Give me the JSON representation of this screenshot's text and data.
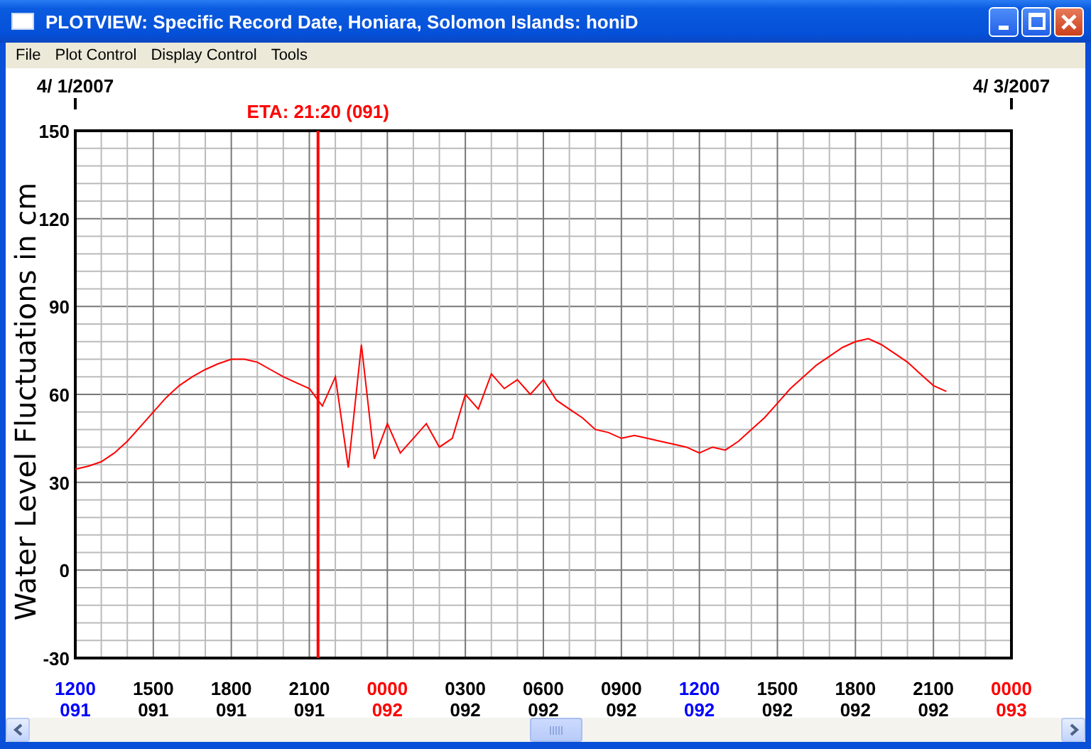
{
  "window": {
    "title": "PLOTVIEW: Specific Record Date, Honiara, Solomon Islands: honiD"
  },
  "menu": [
    "File",
    "Plot Control",
    "Display Control",
    "Tools"
  ],
  "plot": {
    "date_labels": [
      "4/ 1/2007",
      "4/ 3/2007"
    ],
    "day_labels": [
      {
        "day": "091",
        "color": "#0000ff"
      },
      {
        "day": "091",
        "color": "#000000"
      },
      {
        "day": "091",
        "color": "#000000"
      },
      {
        "day": "091",
        "color": "#000000"
      },
      {
        "day": "092",
        "color": "#ff0000"
      },
      {
        "day": "092",
        "color": "#000000"
      },
      {
        "day": "092",
        "color": "#000000"
      },
      {
        "day": "092",
        "color": "#000000"
      },
      {
        "day": "092",
        "color": "#0000ff"
      },
      {
        "day": "092",
        "color": "#000000"
      },
      {
        "day": "092",
        "color": "#000000"
      },
      {
        "day": "092",
        "color": "#000000"
      },
      {
        "day": "093",
        "color": "#ff0000"
      }
    ],
    "chart_data": {
      "type": "line",
      "ylabel": "Water Level Fluctuations in cm",
      "categories": [
        "1200",
        null,
        null,
        null,
        null,
        null,
        "1500",
        null,
        null,
        null,
        null,
        null,
        "1800",
        null,
        null,
        null,
        null,
        null,
        "2100",
        null,
        null,
        null,
        null,
        null,
        "0000",
        null,
        null,
        null,
        null,
        null,
        "0300",
        null,
        null,
        null,
        null,
        null,
        "0600",
        null,
        null,
        null,
        null,
        null,
        "0900",
        null,
        null,
        null,
        null,
        null,
        "1200",
        null,
        null,
        null,
        null,
        null,
        "1500",
        null,
        null,
        null,
        null,
        null,
        "1800",
        null,
        null,
        null,
        null,
        null,
        "2100",
        null,
        null,
        null,
        null,
        null,
        "0000"
      ],
      "series": [
        {
          "color": "#ff0000",
          "values": [
            34.5,
            35.5,
            37,
            40,
            44,
            49,
            54,
            59,
            63,
            66,
            68.5,
            70.5,
            72,
            72,
            71,
            68.5,
            66,
            64,
            62,
            56,
            66,
            35,
            77,
            38,
            50,
            40,
            45,
            50,
            42,
            45,
            60,
            55,
            67,
            62,
            65,
            60,
            65,
            58,
            55,
            52,
            48,
            47,
            45,
            46,
            45,
            44,
            43,
            42,
            40,
            42,
            41,
            44,
            48,
            52,
            57,
            62,
            66,
            70,
            73,
            76,
            78,
            79,
            77,
            74,
            71,
            67,
            63,
            61,
            null,
            null,
            null,
            null,
            null
          ]
        }
      ],
      "ylim": [
        -30,
        150
      ],
      "yticks": [
        -30,
        0,
        30,
        60,
        90,
        120,
        150
      ],
      "grid": true,
      "annotations": [
        "ETA: 21:20 (091)"
      ]
    }
  }
}
